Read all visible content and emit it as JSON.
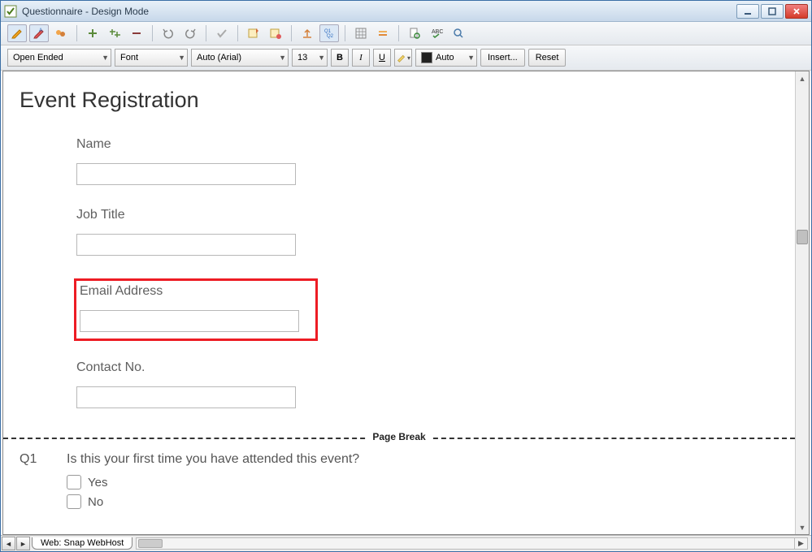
{
  "window": {
    "title": "Questionnaire - Design Mode"
  },
  "format": {
    "question_type": "Open Ended",
    "font_family": "Font",
    "font_name": "Auto (Arial)",
    "font_size": "13",
    "color_mode": "Auto",
    "insert_btn": "Insert...",
    "reset_btn": "Reset"
  },
  "form": {
    "title": "Event Registration",
    "fields": [
      {
        "label": "Name"
      },
      {
        "label": "Job Title"
      },
      {
        "label": "Email Address",
        "selected": true
      },
      {
        "label": "Contact No."
      }
    ],
    "page_break": "Page Break",
    "q1": {
      "num": "Q1",
      "text": "Is this your first time you have attended this event?",
      "options": [
        "Yes",
        "No"
      ]
    }
  },
  "tabs": {
    "web": "Web: Snap WebHost"
  }
}
